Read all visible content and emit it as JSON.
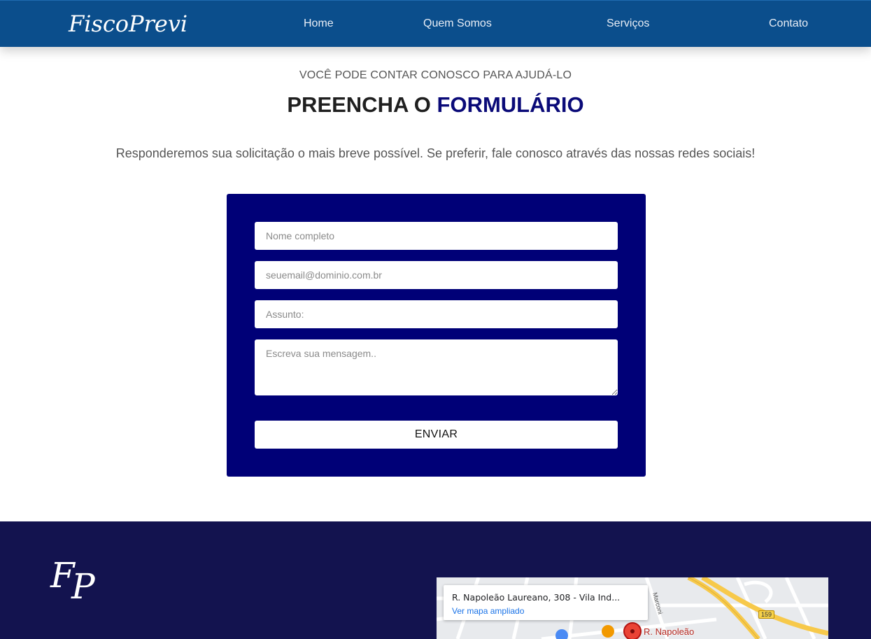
{
  "nav": {
    "brand": "FiscoPrevi",
    "links": [
      {
        "label": "Home"
      },
      {
        "label": "Quem Somos"
      },
      {
        "label": "Serviços"
      },
      {
        "label": "Contato"
      }
    ]
  },
  "hero": {
    "eyebrow": "VOCÊ PODE CONTAR CONOSCO PARA AJUDÁ-LO",
    "heading_part1": "PREENCHA O ",
    "heading_accent": "FORMULÁRIO",
    "intro": "Responderemos sua solicitação o mais breve possível. Se preferir, fale conosco através das nossas redes sociais!"
  },
  "form": {
    "name_placeholder": "Nome completo",
    "email_placeholder": "seuemail@dominio.com.br",
    "subject_placeholder": "Assunto:",
    "message_placeholder": "Escreva sua mensagem..",
    "submit_label": "ENVIAR"
  },
  "footer": {
    "logo_letter_1": "F",
    "logo_letter_2": "P",
    "map": {
      "address": "R. Napoleão Laureano, 308 - Vila Ind...",
      "link_label": "Ver mapa ampliado",
      "pin_label": "R. Napoleão",
      "road_number": "159",
      "street_1": "Marconi"
    }
  },
  "colors": {
    "nav_bg": "#0b4e8c",
    "form_bg": "#000077",
    "footer_bg": "#13134f",
    "accent_heading": "#0a0a78"
  }
}
